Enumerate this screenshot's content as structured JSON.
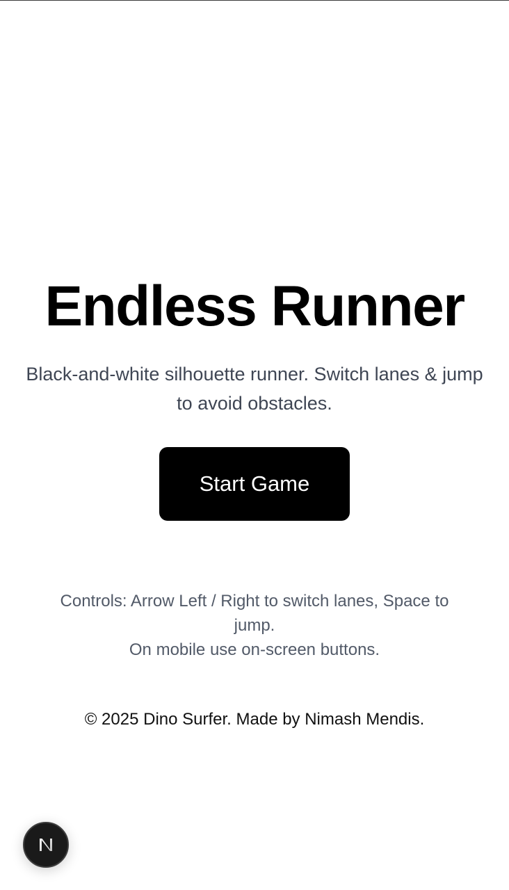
{
  "hero": {
    "title": "Endless Runner",
    "subtitle": "Black-and-white silhouette runner. Switch lanes & jump to avoid obstacles.",
    "start_label": "Start Game"
  },
  "controls": {
    "line1": "Controls: Arrow Left / Right to switch lanes, Space to jump.",
    "line2": "On mobile use on-screen buttons."
  },
  "footer": {
    "copyright": "© 2025 Dino Surfer. Made by Nimash Mendis."
  },
  "badge": {
    "icon": "nextjs-n-icon"
  }
}
